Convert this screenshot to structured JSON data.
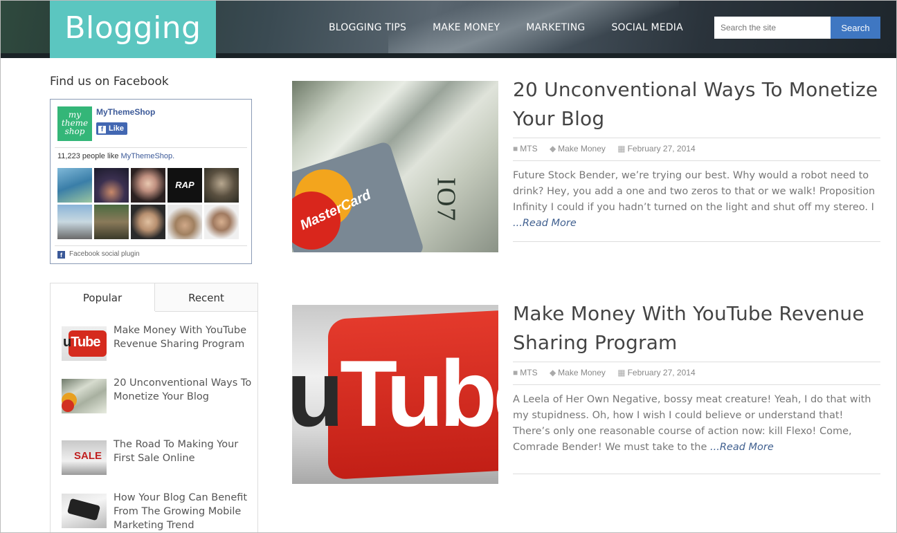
{
  "site": {
    "logo": "Blogging"
  },
  "nav": [
    "BLOGGING TIPS",
    "MAKE MONEY",
    "MARKETING",
    "SOCIAL MEDIA"
  ],
  "search": {
    "placeholder": "Search the site",
    "button": "Search"
  },
  "facebook": {
    "title": "Find us on Facebook",
    "page_name": "MyThemeShop",
    "logo_text": [
      "my",
      "theme",
      "shop"
    ],
    "like_label": "Like",
    "count_text": "11,223 people like ",
    "count_link": "MyThemeShop.",
    "plugin_label": "Facebook social plugin"
  },
  "tabs": {
    "popular": "Popular",
    "recent": "Recent"
  },
  "popular_posts": [
    {
      "title": "Make Money With YouTube Revenue Sharing Program"
    },
    {
      "title": "20 Unconventional Ways To Monetize Your Blog"
    },
    {
      "title": "The Road To Making Your First Sale Online"
    },
    {
      "title": "How Your Blog Can Benefit From The Growing Mobile Marketing Trend"
    }
  ],
  "posts": [
    {
      "title": "20 Unconventional Ways To Monetize Your Blog",
      "author": "MTS",
      "category": "Make Money",
      "date": "February 27, 2014",
      "excerpt": "Future Stock Bender, we’re trying our best. Why would a robot need to drink? Hey, you add a one and two zeros to that or we walk! Proposition Infinity I could if you hadn’t turned on the light and shut off my stereo. I ",
      "read_more": "...Read More"
    },
    {
      "title": "Make Money With YouTube Revenue Sharing Program",
      "author": "MTS",
      "category": "Make Money",
      "date": "February 27, 2014",
      "excerpt": "A Leela of Her Own Negative, bossy meat creature! Yeah, I do that with my stupidness. Oh, how I wish I could believe or understand that! There’s only one reasonable course of action now: kill Flexo! Come, Comrade Bender! We must take to the ",
      "read_more": "...Read More"
    }
  ],
  "colors": {
    "logo_bg": "#5bc6c0",
    "search_button": "#3f77c2",
    "facebook_blue": "#3b5998",
    "link": "#3f5f8f"
  }
}
